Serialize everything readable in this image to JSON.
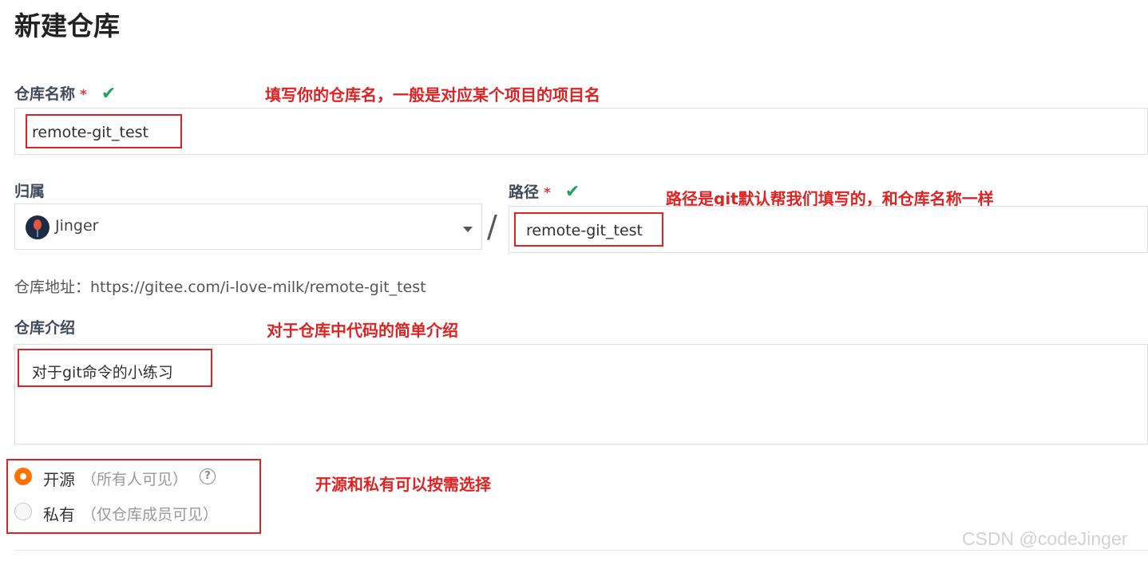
{
  "page": {
    "title": "新建仓库"
  },
  "repo_name": {
    "label": "仓库名称",
    "required_mark": "*",
    "valid_mark": "✔",
    "value": "remote-git_test",
    "annotation": "填写你的仓库名，一般是对应某个项目的项目名"
  },
  "owner": {
    "label": "归属",
    "value": "Jinger",
    "separator": "/"
  },
  "path": {
    "label": "路径",
    "required_mark": "*",
    "valid_mark": "✔",
    "value": "remote-git_test",
    "annotation": "路径是git默认帮我们填写的，和仓库名称一样"
  },
  "repo_address": {
    "text": "仓库地址：https://gitee.com/i-love-milk/remote-git_test"
  },
  "description": {
    "label": "仓库介绍",
    "value": "对于git命令的小练习",
    "annotation": "对于仓库中代码的简单介绍"
  },
  "visibility": {
    "options": [
      {
        "label": "开源",
        "hint": "（所有人可见）",
        "selected": true
      },
      {
        "label": "私有",
        "hint": "（仅仓库成员可见）",
        "selected": false
      }
    ],
    "help_glyph": "?",
    "annotation": "开源和私有可以按需选择"
  },
  "watermark": "CSDN @codeJinger",
  "colors": {
    "accent_radio": "#fe7300",
    "annotation_red": "#e02222",
    "valid_green": "#21a25e",
    "required_red": "#e4393c"
  }
}
